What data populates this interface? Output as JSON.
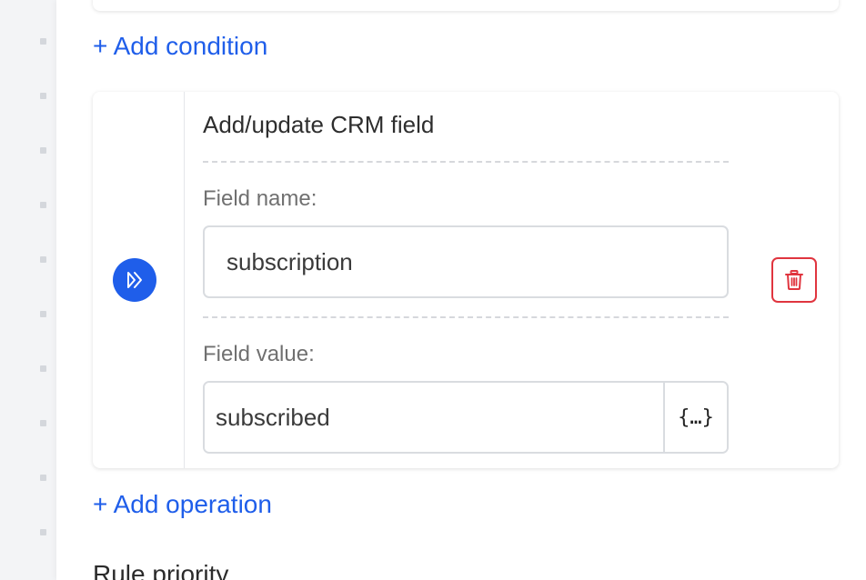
{
  "links": {
    "add_condition": "+ Add condition",
    "add_operation": "+ Add operation"
  },
  "operation": {
    "title": "Add/update CRM field",
    "field_name_label": "Field name:",
    "field_name_value": "subscription",
    "field_value_label": "Field value:",
    "field_value_value": "subscribed",
    "variable_button_label": "{…}"
  },
  "rule_priority_label": "Rule priority",
  "icons": {
    "operation": "double-chevron-right-icon",
    "delete": "trash-icon"
  },
  "colors": {
    "accent": "#1f5eea",
    "danger": "#e0353f"
  }
}
